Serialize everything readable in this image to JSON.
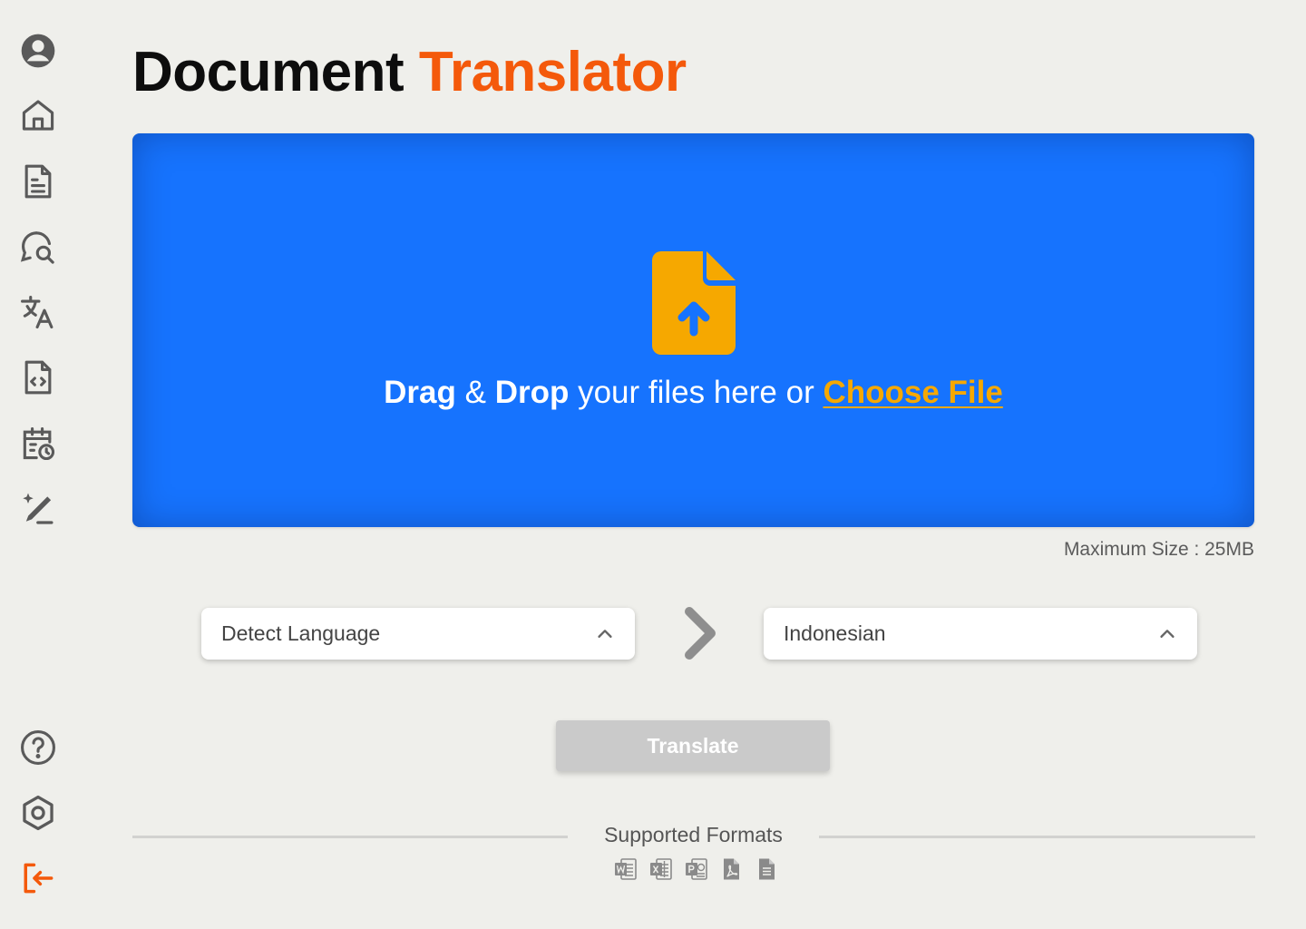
{
  "title": {
    "part1": "Document",
    "part2": "Translator"
  },
  "sidebar": {
    "top_items": [
      {
        "icon": "user-circle-icon"
      },
      {
        "icon": "home-icon"
      },
      {
        "icon": "document-icon"
      },
      {
        "icon": "chat-search-icon"
      },
      {
        "icon": "translate-icon"
      },
      {
        "icon": "code-file-icon"
      },
      {
        "icon": "calendar-clock-icon"
      },
      {
        "icon": "magic-pen-icon"
      }
    ],
    "bottom_items": [
      {
        "icon": "help-icon"
      },
      {
        "icon": "settings-icon"
      },
      {
        "icon": "logout-icon"
      }
    ]
  },
  "dropzone": {
    "drag": "Drag",
    "amp": " & ",
    "drop": "Drop",
    "middle": " your files here or ",
    "choose": "Choose File"
  },
  "max_size": "Maximum Size : 25MB",
  "source_language": "Detect Language",
  "target_language": "Indonesian",
  "translate_label": "Translate",
  "formats": {
    "title": "Supported Formats",
    "icons": [
      "word-icon",
      "excel-icon",
      "powerpoint-icon",
      "pdf-icon",
      "text-file-icon"
    ]
  },
  "colors": {
    "accent": "#f4590b",
    "dropzone_blue": "#1673fe",
    "choose_yellow": "#f6a800",
    "background": "#efefeb"
  }
}
